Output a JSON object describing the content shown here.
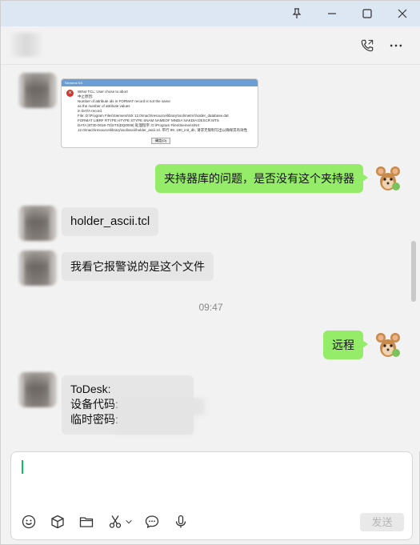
{
  "header": {
    "contact_name": ""
  },
  "messages": {
    "m1_image_title": "Siemens NX",
    "m1_image_line1": "WIN4 TCL: User chose to abort",
    "m1_image_line2": "中止原因:",
    "m1_image_line3": "Number of attribute ids in FORMAT record is not the same",
    "m1_image_line4": "as the number of attribute values",
    "m1_image_line5": "in DATA record.",
    "m1_image_line6": "File: D:\\Program Files\\Siemens\\NX 12.0\\mach\\resource\\library\\tool\\metric\\holder_database.dat",
    "m1_image_line7": "FORMAT LIBRF RTYPE HTYPE STYPE SNAM NAMEOF MNDIA NAKDIA DESCR MTS",
    "m1_image_line8": "DATA |8730-0016-70|STS|DQ0008| 处理程序: D:\\Program Files\\Siemens\\NX",
    "m1_image_line9": "12.0\\mach\\resource\\library\\tool\\ascii\\holder_ascii.tcl.  带行 99, 190_init_db, 请求无限制写出以确保其有效性",
    "m1_image_ok": "确定(O)",
    "m2": "夹持器库的问题，是否没有这个夹持器",
    "m3": "holder_ascii.tcl",
    "m4": "我看它报警说的是这个文件",
    "time1": "09:47",
    "m5": "远程",
    "m6_line1": "ToDesk:",
    "m6_line2": "设备代码:",
    "m6_line3": "临时密码:"
  },
  "input": {
    "value": "",
    "send_label": "发送"
  },
  "icons": {
    "titlebar": [
      "pin-icon",
      "minimize-icon",
      "maximize-icon",
      "close-icon"
    ],
    "header": [
      "voice-call-icon",
      "more-icon"
    ],
    "toolbar": [
      "emoji-icon",
      "box-icon",
      "folder-icon",
      "scissors-icon",
      "chevron-down-icon",
      "chat-bubble-icon",
      "microphone-icon"
    ]
  },
  "colors": {
    "accent": "#07c160",
    "bubble_out": "#95ec69",
    "bubble_in": "#e6e6e6",
    "titlebar": "#dde7f3"
  }
}
